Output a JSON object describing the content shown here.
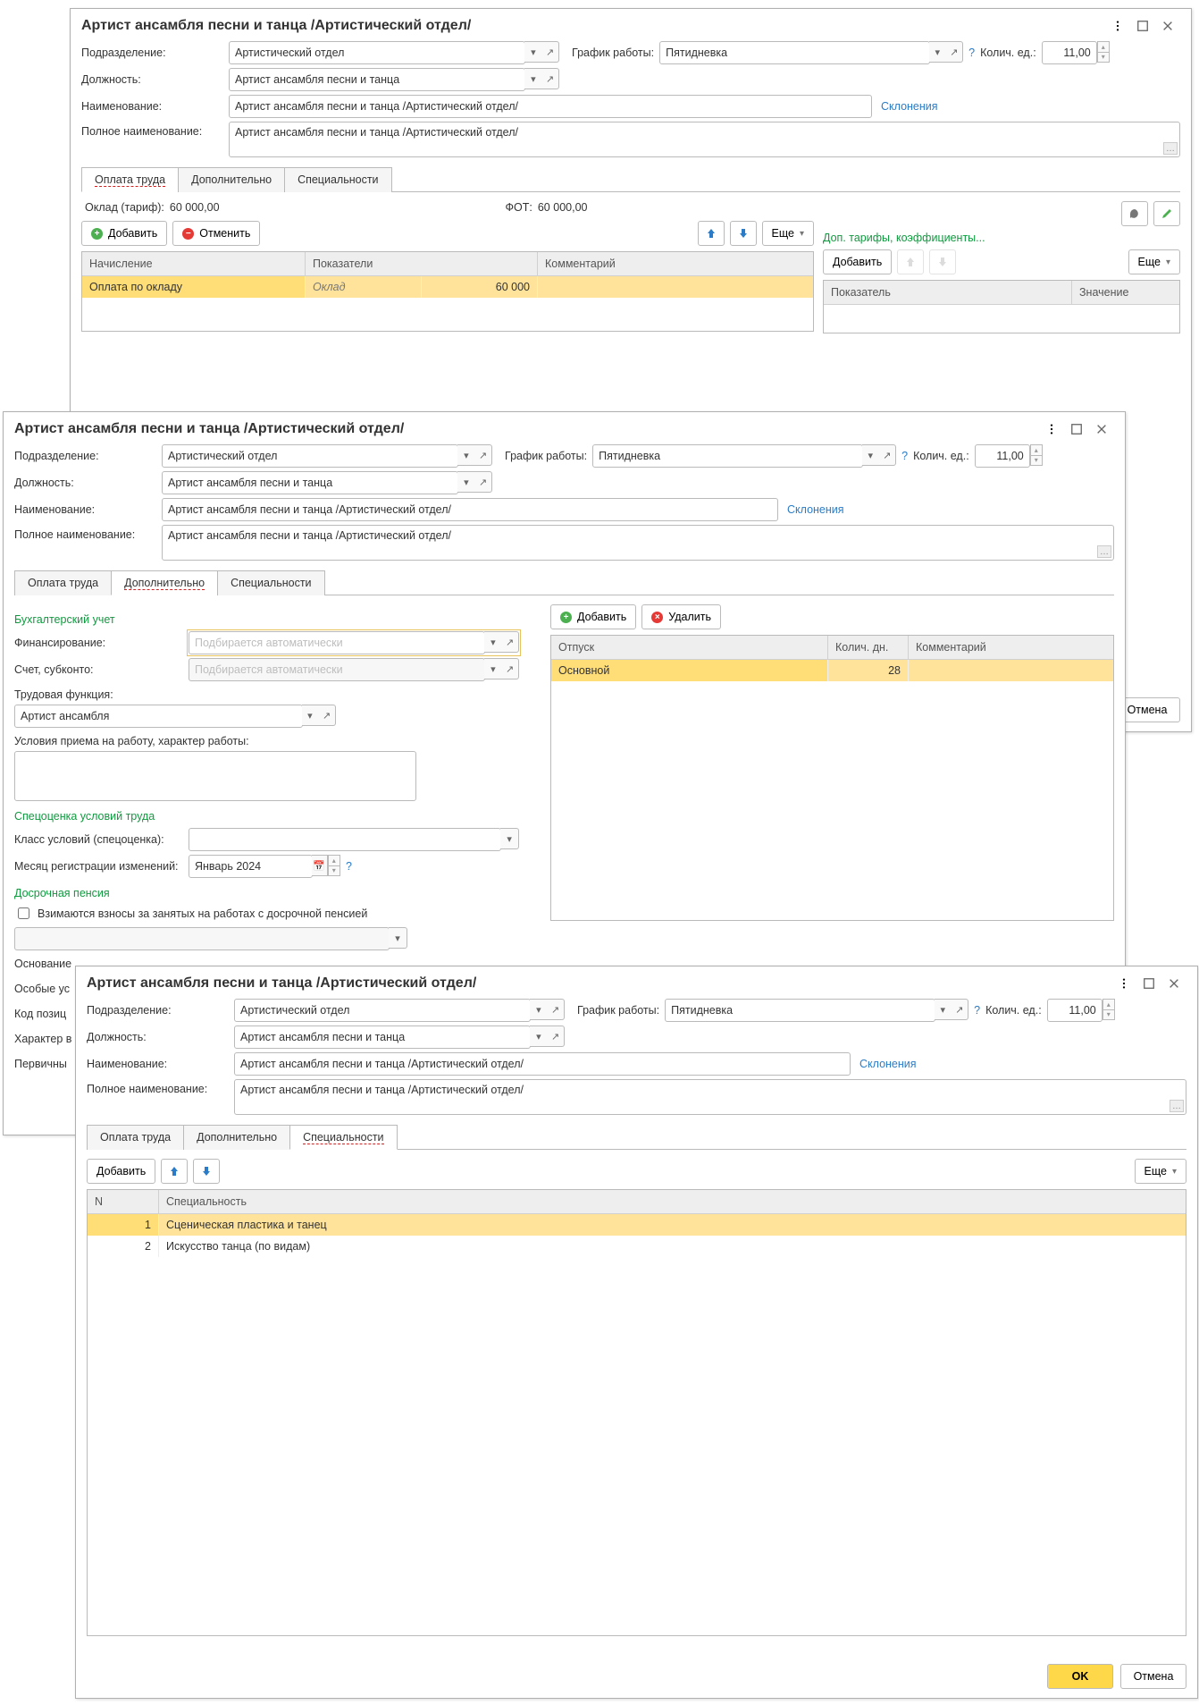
{
  "common": {
    "title": "Артист ансамбля песни и танца /Артистический отдел/",
    "labels": {
      "subdivision": "Подразделение:",
      "position": "Должность:",
      "name": "Наименование:",
      "full_name": "Полное наименование:",
      "schedule": "График работы:",
      "qty": "Колич. ед.:"
    },
    "values": {
      "subdivision": "Артистический отдел",
      "position": "Артист ансамбля песни и танца",
      "name": "Артист ансамбля песни и танца /Артистический отдел/",
      "full_name": "Артист ансамбля песни и танца /Артистический отдел/",
      "schedule": "Пятидневка",
      "qty": "11,00"
    },
    "declensions": "Склонения",
    "tabs": {
      "pay": "Оплата труда",
      "add": "Дополнительно",
      "spec": "Специальности"
    },
    "buttons": {
      "add": "Добавить",
      "delete": "Удалить",
      "cancel_action": "Отменить",
      "more": "Еще",
      "ok": "OK",
      "cancel": "Отмена"
    }
  },
  "w1": {
    "salary_label": "Оклад (тариф):",
    "salary_value": "60 000,00",
    "fot_label": "ФОТ:",
    "fot_value": "60 000,00",
    "grid": {
      "headers": {
        "accrual": "Начисление",
        "metrics": "Показатели",
        "comment": "Комментарий"
      },
      "row": {
        "accrual": "Оплата по окладу",
        "metric_name": "Оклад",
        "metric_value": "60 000"
      }
    },
    "extra_link": "Доп. тарифы, коэффициенты...",
    "side_headers": {
      "indicator": "Показатель",
      "value": "Значение"
    }
  },
  "w2": {
    "accounting": "Бухгалтерский учет",
    "labels": {
      "financing": "Финансирование:",
      "account": "Счет, субконто:",
      "work_func": "Трудовая функция:",
      "conditions": "Условия приема на работу, характер работы:",
      "spec_assess": "Спецоценка условий труда",
      "class": "Класс условий (спецоценка):",
      "reg_month": "Месяц регистрации изменений:",
      "early_pension": "Досрочная пенсия",
      "checkbox": "Взимаются взносы за занятых на работах с досрочной пенсией",
      "basis": "Основание",
      "special": "Особые ус",
      "code": "Код позиц",
      "character": "Характер в",
      "primary": "Первичны"
    },
    "placeholders": {
      "financing": "Подбирается автоматически",
      "account": "Подбирается автоматически"
    },
    "values": {
      "work_func": "Артист ансамбля",
      "reg_month": "Январь 2024"
    },
    "leave_grid": {
      "headers": {
        "leave": "Отпуск",
        "days": "Колич. дн.",
        "comment": "Комментарий"
      },
      "row": {
        "leave": "Основной",
        "days": "28"
      }
    }
  },
  "w3": {
    "grid": {
      "headers": {
        "n": "N",
        "spec": "Специальность"
      },
      "rows": [
        {
          "n": "1",
          "spec": "Сценическая пластика и танец"
        },
        {
          "n": "2",
          "spec": "Искусство танца (по видам)"
        }
      ]
    }
  }
}
